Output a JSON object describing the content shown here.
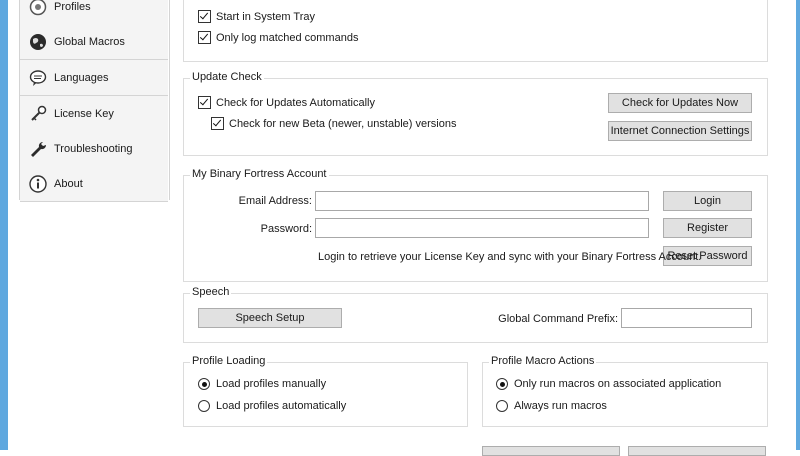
{
  "sidebar": {
    "items": [
      {
        "label": "Profiles",
        "icon": "profiles-icon"
      },
      {
        "label": "Global Macros",
        "icon": "globe-icon"
      },
      {
        "label": "Languages",
        "icon": "speech-bubble-icon"
      },
      {
        "label": "License Key",
        "icon": "key-icon"
      },
      {
        "label": "Troubleshooting",
        "icon": "wrench-icon"
      },
      {
        "label": "About",
        "icon": "info-icon"
      }
    ]
  },
  "general": {
    "start_in_tray": {
      "label": "Start in System Tray",
      "checked": true
    },
    "only_log_matched": {
      "label": "Only log matched commands",
      "checked": true
    }
  },
  "update_check": {
    "title": "Update Check",
    "check_auto": {
      "label": "Check for Updates Automatically",
      "checked": true
    },
    "check_beta": {
      "label": "Check for new Beta (newer, unstable) versions",
      "checked": true
    },
    "check_now_button": "Check for Updates Now",
    "connection_settings_button": "Internet Connection Settings"
  },
  "account": {
    "title": "My Binary Fortress Account",
    "email_label": "Email Address:",
    "email_value": "",
    "password_label": "Password:",
    "password_value": "",
    "login_button": "Login",
    "register_button": "Register",
    "reset_password_button": "Reset Password",
    "info_text": "Login to retrieve your License Key and sync with your Binary Fortress Account."
  },
  "speech": {
    "title": "Speech",
    "setup_button": "Speech Setup",
    "prefix_label": "Global Command Prefix:",
    "prefix_value": ""
  },
  "profile_loading": {
    "title": "Profile Loading",
    "options": [
      {
        "label": "Load profiles manually",
        "selected": true
      },
      {
        "label": "Load profiles automatically",
        "selected": false
      }
    ]
  },
  "profile_macro_actions": {
    "title": "Profile Macro Actions",
    "options": [
      {
        "label": "Only run macros on associated application",
        "selected": true
      },
      {
        "label": "Always run macros",
        "selected": false
      }
    ]
  },
  "colors": {
    "window_border": "#5fa8df",
    "button_face": "#e1e1e1",
    "group_border": "#dcdcdc"
  }
}
